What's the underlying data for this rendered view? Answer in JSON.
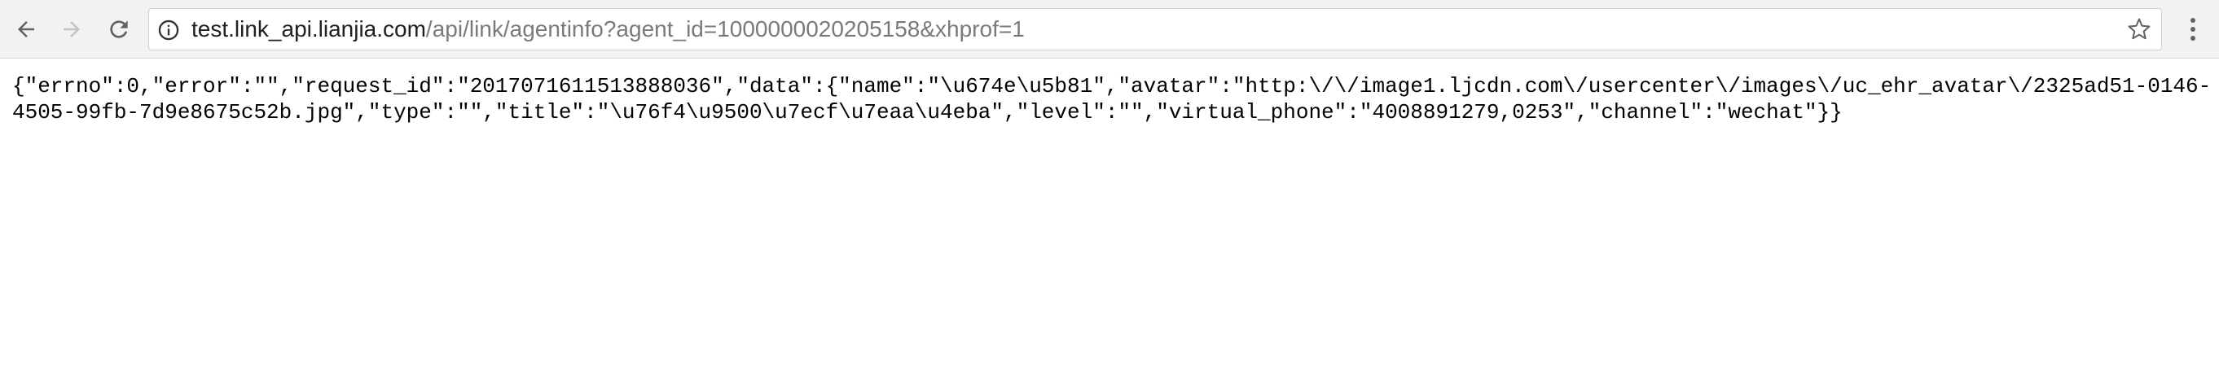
{
  "browser": {
    "address_bar": {
      "host": "test.link_api.lianjia.com",
      "path": "/api/link/agentinfo?agent_id=1000000020205158&xhprof=1"
    },
    "icons": {
      "back": "back-arrow-icon",
      "forward": "forward-arrow-icon",
      "reload": "reload-icon",
      "site_info": "info-icon",
      "bookmark": "star-icon",
      "menu": "more-vert-icon"
    },
    "colors": {
      "toolbar": "#f2f2f2",
      "host_text": "#202020",
      "path_text": "#7a7a7a"
    }
  },
  "page": {
    "raw_text": "{\"errno\":0,\"error\":\"\",\"request_id\":\"2017071611513888036\",\"data\":{\"name\":\"\\u674e\\u5b81\",\"avatar\":\"http:\\/\\/image1.ljcdn.com\\/usercenter\\/images\\/uc_ehr_avatar\\/2325ad51-0146-4505-99fb-7d9e8675c52b.jpg\",\"type\":\"\",\"title\":\"\\u76f4\\u9500\\u7ecf\\u7eaa\\u4eba\",\"level\":\"\",\"virtual_phone\":\"4008891279,0253\",\"channel\":\"wechat\"}}"
  }
}
